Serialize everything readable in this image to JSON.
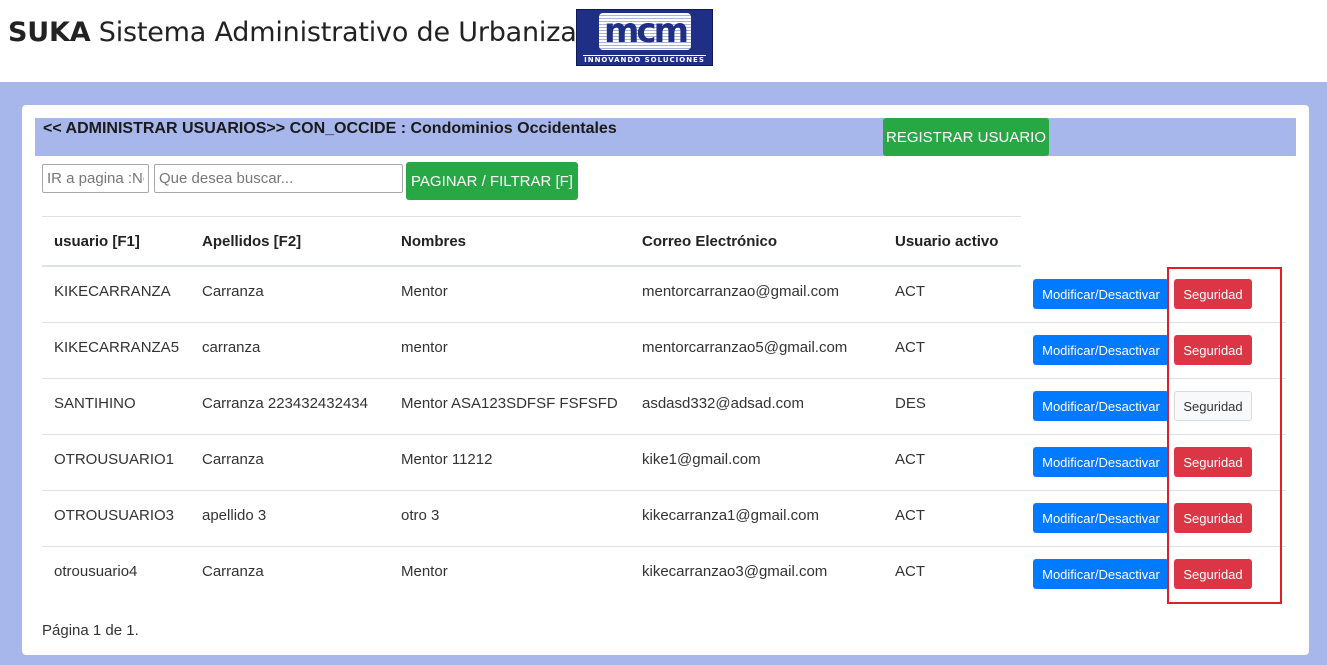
{
  "header": {
    "brand_bold": "SUKA",
    "brand_rest": "Sistema Administrativo de Urbanizaciones",
    "logo_text": "mcm",
    "logo_tagline": "INNOVANDO   SOLUCIONES"
  },
  "panel": {
    "title": "<< ADMINISTRAR USUARIOS>> CON_OCCIDE : Condominios Occidentales",
    "register_button": "REGISTRAR USUARIO"
  },
  "filters": {
    "page_placeholder": "IR a pagina :No",
    "search_placeholder": "Que desea buscar...",
    "filter_button": "PAGINAR / FILTRAR [F]"
  },
  "table": {
    "headers": [
      "usuario [F1]",
      "Apellidos [F2]",
      "Nombres",
      "Correo Electrónico",
      "Usuario activo"
    ],
    "modify_label": "Modificar/Desactivar",
    "security_label": "Seguridad",
    "rows": [
      {
        "usuario": "KIKECARRANZA",
        "apellidos": "Carranza",
        "nombres": "Mentor",
        "correo": "mentorcarranzao@gmail.com",
        "activo": "ACT"
      },
      {
        "usuario": "KIKECARRANZA5",
        "apellidos": "carranza",
        "nombres": "mentor",
        "correo": "mentorcarranzao5@gmail.com",
        "activo": "ACT"
      },
      {
        "usuario": "SANTIHINO",
        "apellidos": "Carranza 223432432434",
        "nombres": "Mentor ASA123SDFSF FSFSFD",
        "correo": "asdasd332@adsad.com",
        "activo": "DES"
      },
      {
        "usuario": "OTROUSUARIO1",
        "apellidos": "Carranza",
        "nombres": "Mentor 11212",
        "correo": "kike1@gmail.com",
        "activo": "ACT"
      },
      {
        "usuario": "OTROUSUARIO3",
        "apellidos": "apellido 3",
        "nombres": "otro 3",
        "correo": "kikecarranza1@gmail.com",
        "activo": "ACT"
      },
      {
        "usuario": "otrousuario4",
        "apellidos": "Carranza",
        "nombres": "Mentor",
        "correo": "kikecarranzao3@gmail.com",
        "activo": "ACT"
      }
    ]
  },
  "pagination": {
    "text": "Página 1 de 1."
  },
  "colors": {
    "background_band": "#a7b7ec",
    "success": "#28a745",
    "primary": "#007bff",
    "danger": "#dc3545",
    "highlight_box": "#dc1f2b"
  }
}
